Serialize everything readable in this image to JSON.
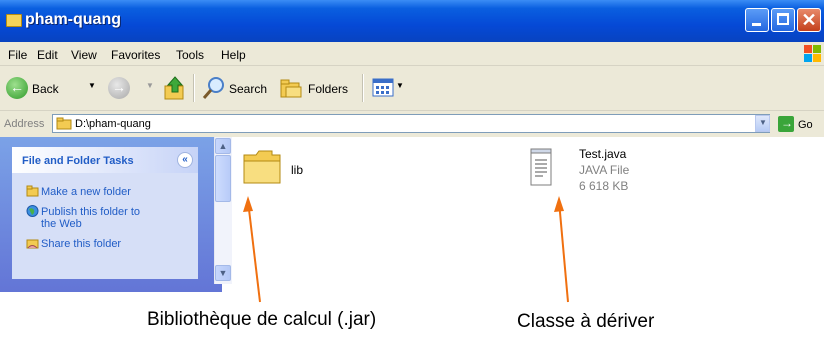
{
  "window": {
    "title": "pham-quang"
  },
  "menu": [
    "File",
    "Edit",
    "View",
    "Favorites",
    "Tools",
    "Help"
  ],
  "toolbar": {
    "back_label": "Back",
    "search_label": "Search",
    "folders_label": "Folders"
  },
  "address": {
    "label": "Address",
    "value": "D:\\pham-quang",
    "go_label": "Go"
  },
  "tasks": {
    "header": "File and Folder Tasks",
    "items": [
      "Make a new folder",
      "Publish this folder to the Web",
      "Share this folder"
    ]
  },
  "files": [
    {
      "name": "lib",
      "icon": "folder-icon"
    },
    {
      "name": "Test.java",
      "type": "JAVA File",
      "size": "6 618 KB",
      "icon": "text-file-icon"
    }
  ],
  "callouts": {
    "left": "Bibliothèque de calcul (.jar)",
    "right": "Classe à dériver"
  },
  "colors": {
    "title_bar": "#0549d6",
    "task_pane": "#6f8fe0",
    "link": "#215dc6",
    "arrow": "#f07010"
  }
}
